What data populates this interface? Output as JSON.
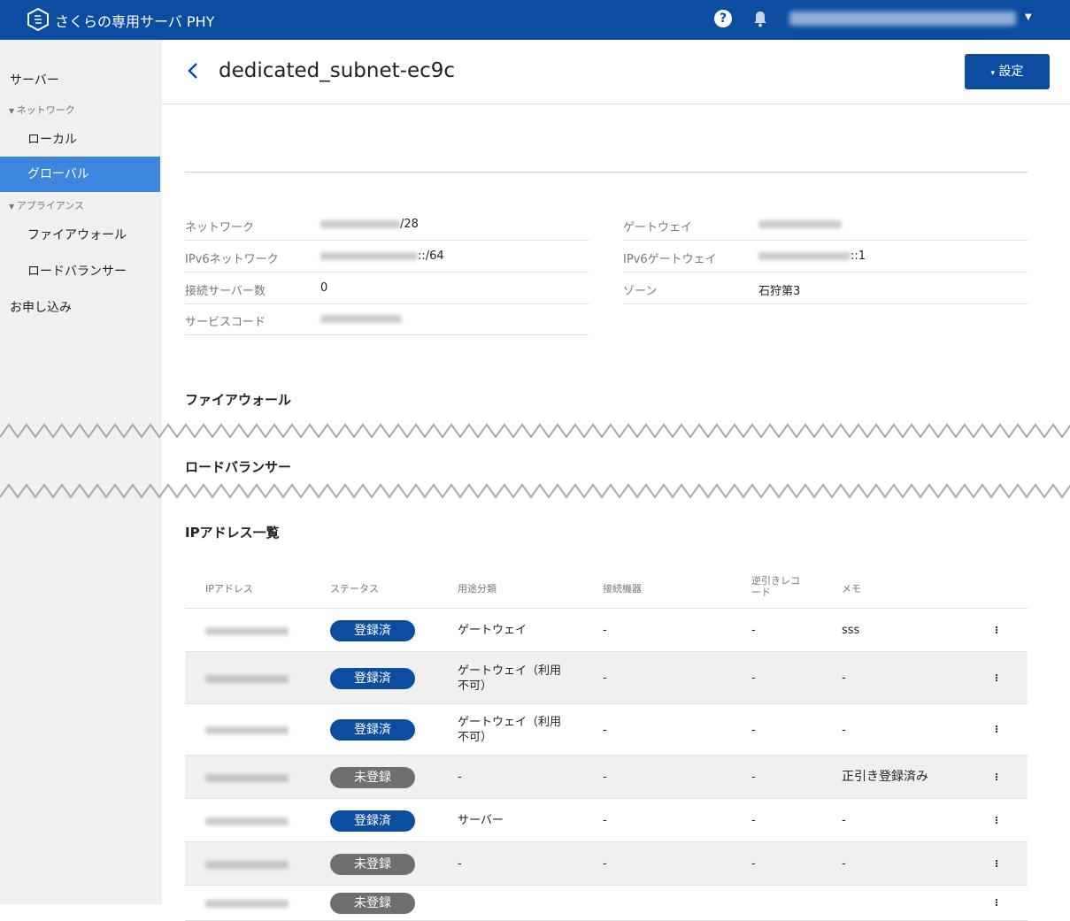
{
  "topbar": {
    "brand": "さくらの専用サーバ PHY",
    "icons": [
      "logo-icon",
      "help-icon",
      "bell-icon",
      "chevron-down-icon"
    ]
  },
  "sidebar": {
    "items": [
      {
        "label": "サーバー"
      },
      {
        "label": "ネットワーク",
        "group": true
      },
      {
        "label": "ローカル"
      },
      {
        "label": "グローバル",
        "active": true
      },
      {
        "label": "アプライアンス",
        "group": true
      },
      {
        "label": "ファイアウォール"
      },
      {
        "label": "ロードバランサー"
      },
      {
        "label": "お申し込み"
      }
    ]
  },
  "header": {
    "title": "dedicated_subnet-ec9c",
    "settings_label": "設定",
    "settings_prefix": "▾"
  },
  "info": {
    "left": [
      {
        "label": "ネットワーク",
        "value_suffix": "/28"
      },
      {
        "label": "IPv6ネットワーク",
        "value_suffix": "::/64"
      },
      {
        "label": "接続サーバー数",
        "value": "0"
      },
      {
        "label": "サービスコード"
      }
    ],
    "right": [
      {
        "label": "ゲートウェイ"
      },
      {
        "label": "IPv6ゲートウェイ",
        "value_suffix": "::1"
      },
      {
        "label": "ゾーン",
        "value": "石狩第3"
      }
    ]
  },
  "sections": {
    "firewall": "ファイアウォール",
    "loadbalancer": "ロードバランサー",
    "ip_list": "IPアドレス一覧"
  },
  "table": {
    "headers": [
      "IPアドレス",
      "ステータス",
      "用途分類",
      "接続機器",
      "逆引きレコード",
      "メモ"
    ],
    "rows": [
      {
        "status": "登録済",
        "usage": "ゲートウェイ",
        "device": "-",
        "reverse": "-",
        "memo": "sss"
      },
      {
        "status": "登録済",
        "usage": "ゲートウェイ（利用不可）",
        "device": "-",
        "reverse": "-",
        "memo": "-"
      },
      {
        "status": "登録済",
        "usage": "ゲートウェイ（利用不可）",
        "device": "-",
        "reverse": "-",
        "memo": "-"
      },
      {
        "status": "未登録",
        "usage": "-",
        "device": "-",
        "reverse": "-",
        "memo": "正引き登録済み"
      },
      {
        "status": "登録済",
        "usage": "サーバー",
        "device": "-",
        "reverse": "-",
        "memo": "-"
      },
      {
        "status": "未登録",
        "usage": "-",
        "device": "-",
        "reverse": "-",
        "memo": "-"
      },
      {
        "status": "未登録"
      }
    ]
  },
  "colors": {
    "brand_blue": "#0c4da2",
    "sidebar_active": "#3c87dd",
    "badge_unregistered": "#6f6f6f"
  }
}
